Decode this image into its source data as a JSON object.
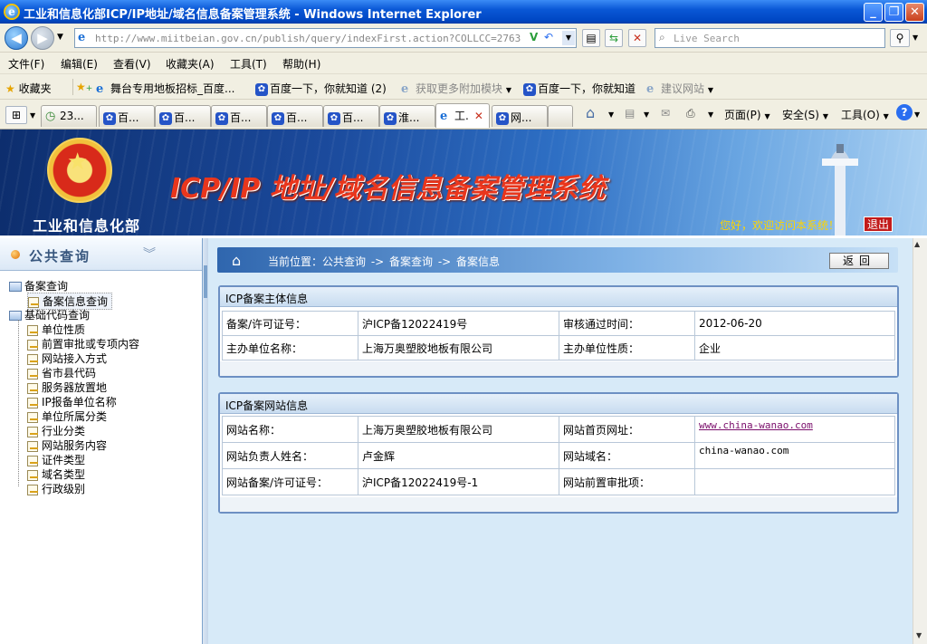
{
  "window": {
    "title": "工业和信息化部ICP/IP地址/域名信息备案管理系统 - Windows Internet Explorer",
    "minimize": "_",
    "restore": "❐",
    "close": "✕"
  },
  "address": {
    "url": "http://www.miitbeian.gov.cn/publish/query/indexFirst.action?COLLCC=2763759980&",
    "search_placeholder": "Live Search"
  },
  "menu": [
    "文件(F)",
    "编辑(E)",
    "查看(V)",
    "收藏夹(A)",
    "工具(T)",
    "帮助(H)"
  ],
  "favorites": {
    "label": "收藏夹",
    "items": [
      {
        "label": "舞台专用地板招标_百度...",
        "gray": false
      },
      {
        "label": "百度一下，你就知道 (2)",
        "gray": false
      },
      {
        "label": "获取更多附加模块",
        "gray": true
      },
      {
        "label": "百度一下，你就知道",
        "gray": false
      },
      {
        "label": "建议网站",
        "gray": true
      }
    ]
  },
  "tabs": [
    {
      "label": "23..."
    },
    {
      "label": "百..."
    },
    {
      "label": "百..."
    },
    {
      "label": "百..."
    },
    {
      "label": "百..."
    },
    {
      "label": "百..."
    },
    {
      "label": "淮..."
    },
    {
      "label": "工."
    },
    {
      "label": "网..."
    }
  ],
  "commands": {
    "page": "页面(P)",
    "safety": "安全(S)",
    "tools": "工具(O)"
  },
  "banner": {
    "ministry": "工业和信息化部",
    "system_title": "ICP/IP 地址/域名信息备案管理系统",
    "welcome": "您好，欢迎访问本系统！",
    "logout": "退出"
  },
  "sidebar": {
    "header": "公共查询",
    "groups": [
      {
        "label": "备案查询",
        "items": [
          "备案信息查询"
        ]
      },
      {
        "label": "基础代码查询",
        "items": [
          "单位性质",
          "前置审批或专项内容",
          "网站接入方式",
          "省市县代码",
          "服务器放置地",
          "IP报备单位名称",
          "单位所属分类",
          "行业分类",
          "网站服务内容",
          "证件类型",
          "域名类型",
          "行政级别"
        ]
      }
    ]
  },
  "breadcrumb": {
    "text": "当前位置：公共查询  -> 备案查询  -> 备案信息",
    "back": "返回"
  },
  "subject": {
    "title": "ICP备案主体信息",
    "rows": [
      {
        "l1": "备案/许可证号：",
        "v1": "沪ICP备12022419号",
        "l2": "审核通过时间：",
        "v2": "2012-06-20"
      },
      {
        "l1": "主办单位名称：",
        "v1": "上海万奥塑胶地板有限公司",
        "l2": "主办单位性质：",
        "v2": "企业"
      }
    ]
  },
  "site": {
    "title": "ICP备案网站信息",
    "rows": [
      {
        "l1": "网站名称：",
        "v1": "上海万奥塑胶地板有限公司",
        "l2": "网站首页网址：",
        "v2": "www.china-wanao.com"
      },
      {
        "l1": "网站负责人姓名：",
        "v1": "卢金辉",
        "l2": "网站域名：",
        "v2": "china-wanao.com"
      },
      {
        "l1": "网站备案/许可证号：",
        "v1": "沪ICP备12022419号-1",
        "l2": "网站前置审批项：",
        "v2": ""
      }
    ]
  }
}
